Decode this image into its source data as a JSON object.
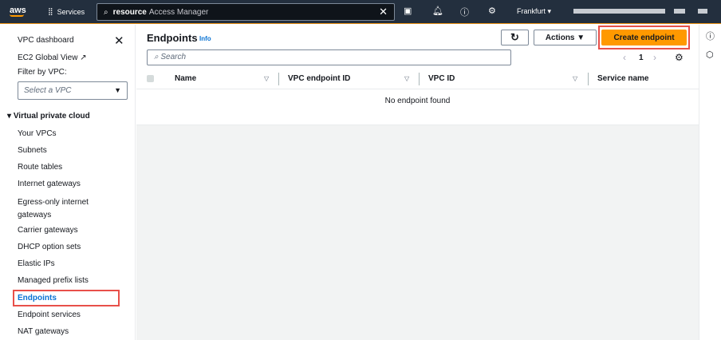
{
  "topbar": {
    "logo": "aws",
    "services": "Services",
    "search_bold": "resource",
    "search_rest": "Access Manager",
    "region": "Frankfurt"
  },
  "sidebar": {
    "dashboard": "VPC dashboard",
    "global": "EC2 Global View",
    "filter_label": "Filter by VPC:",
    "filter_placeholder": "Select a VPC",
    "section": "Virtual private cloud",
    "items": [
      "Your VPCs",
      "Subnets",
      "Route tables",
      "Internet gateways",
      "Egress-only internet gateways",
      "Carrier gateways",
      "DHCP option sets",
      "Elastic IPs",
      "Managed prefix lists",
      "Endpoints",
      "Endpoint services",
      "NAT gateways"
    ]
  },
  "main": {
    "title": "Endpoints",
    "info": "Info",
    "actions": "Actions",
    "create": "Create endpoint",
    "search_placeholder": "Search",
    "page": "1",
    "columns": [
      "Name",
      "VPC endpoint ID",
      "VPC ID",
      "Service name"
    ],
    "empty": "No endpoint found"
  },
  "colors": {
    "accent": "#ff9900",
    "link": "#0972d3",
    "highlight": "#e8504a"
  }
}
